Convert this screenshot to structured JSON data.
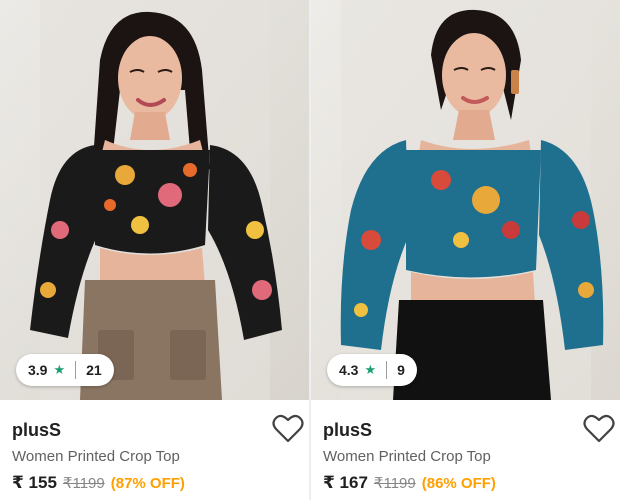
{
  "products": [
    {
      "brand": "plusS",
      "title": "Women Printed Crop Top",
      "price": "₹ 155",
      "mrp": "₹1199",
      "discount": "(87% OFF)",
      "rating": "3.9",
      "rating_count": "21",
      "top_color": "#1a1a1a",
      "bottom_color": "#8a7563"
    },
    {
      "brand": "plusS",
      "title": "Women Printed Crop Top",
      "price": "₹ 167",
      "mrp": "₹1199",
      "discount": "(86% OFF)",
      "rating": "4.3",
      "rating_count": "9",
      "top_color": "#1f6f8e",
      "bottom_color": "#111111"
    }
  ],
  "icons": {
    "star": "star-icon",
    "wishlist": "heart-outline-icon"
  },
  "colors": {
    "rating_star": "#1b9d73",
    "discount": "#ff9f00",
    "mrp": "#878787",
    "title": "#616161"
  }
}
